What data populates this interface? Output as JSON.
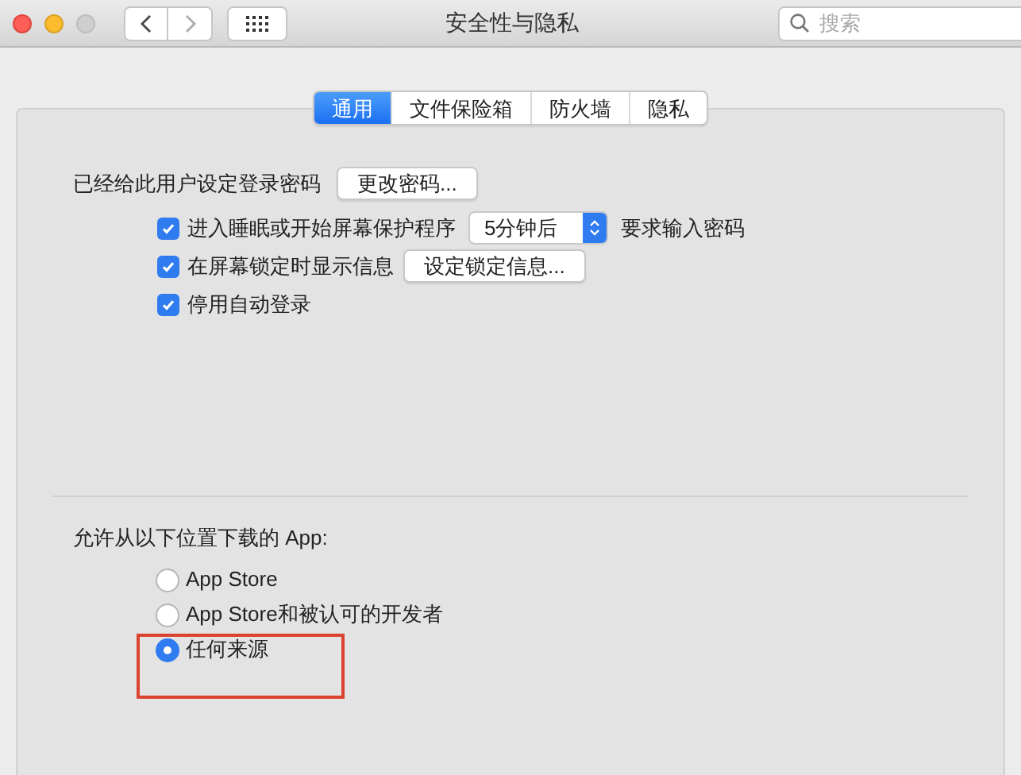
{
  "window": {
    "title": "安全性与隐私"
  },
  "search": {
    "placeholder": "搜索"
  },
  "tabs": [
    {
      "label": "通用",
      "selected": true
    },
    {
      "label": "文件保险箱",
      "selected": false
    },
    {
      "label": "防火墙",
      "selected": false
    },
    {
      "label": "隐私",
      "selected": false
    }
  ],
  "password": {
    "label": "已经给此用户设定登录密码",
    "button": "更改密码..."
  },
  "options": [
    {
      "kind": "select",
      "label": "进入睡眠或开始屏幕保护程序",
      "checked": true,
      "value": "5分钟后",
      "suffix": "要求输入密码"
    },
    {
      "kind": "button",
      "label": "在屏幕锁定时显示信息",
      "checked": true,
      "button": "设定锁定信息..."
    },
    {
      "kind": "plain",
      "label": "停用自动登录",
      "checked": true
    }
  ],
  "downloads": {
    "label": "允许从以下位置下载的 App:",
    "choices": [
      {
        "label": "App Store",
        "selected": false,
        "highlighted": false
      },
      {
        "label": "App Store和被认可的开发者",
        "selected": false,
        "highlighted": false
      },
      {
        "label": "任何来源",
        "selected": true,
        "highlighted": true
      }
    ]
  }
}
